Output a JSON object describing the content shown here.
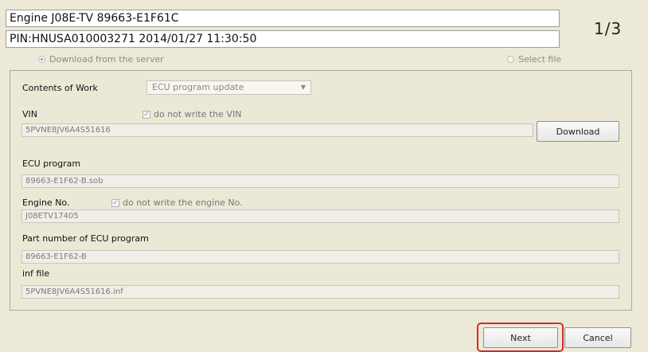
{
  "header": {
    "engine_line": "Engine J08E-TV 89663-E1F61C",
    "pin_line": "PIN:HNUSA010003271 2014/01/27 11:30:50",
    "page_indicator": "1/3"
  },
  "source": {
    "download_option": {
      "label": "Download from the server",
      "checked": true
    },
    "select_file_option": {
      "label": "Select file",
      "checked": false
    }
  },
  "form": {
    "contents_of_work": {
      "label": "Contents of Work",
      "value": "ECU program update"
    },
    "vin": {
      "label": "VIN",
      "checkbox_label": "do not write the VIN",
      "checked": true,
      "value": "5PVNE8JV6A4S51616",
      "download_button": "Download"
    },
    "ecu_program": {
      "label": "ECU program",
      "value": "89663-E1F62-B.sob"
    },
    "engine_no": {
      "label": "Engine No.",
      "checkbox_label": "do not write the engine No.",
      "checked": true,
      "value": "J08ETV17405"
    },
    "part_number": {
      "label": "Part number of ECU program",
      "value": "89663-E1F62-B"
    },
    "inf_file": {
      "label": "inf file",
      "value": "5PVNE8JV6A4S51616.inf"
    }
  },
  "footer": {
    "next_button": "Next",
    "cancel_button": "Cancel"
  },
  "colors": {
    "background": "#ece9d8",
    "highlight": "#d42a2a"
  }
}
